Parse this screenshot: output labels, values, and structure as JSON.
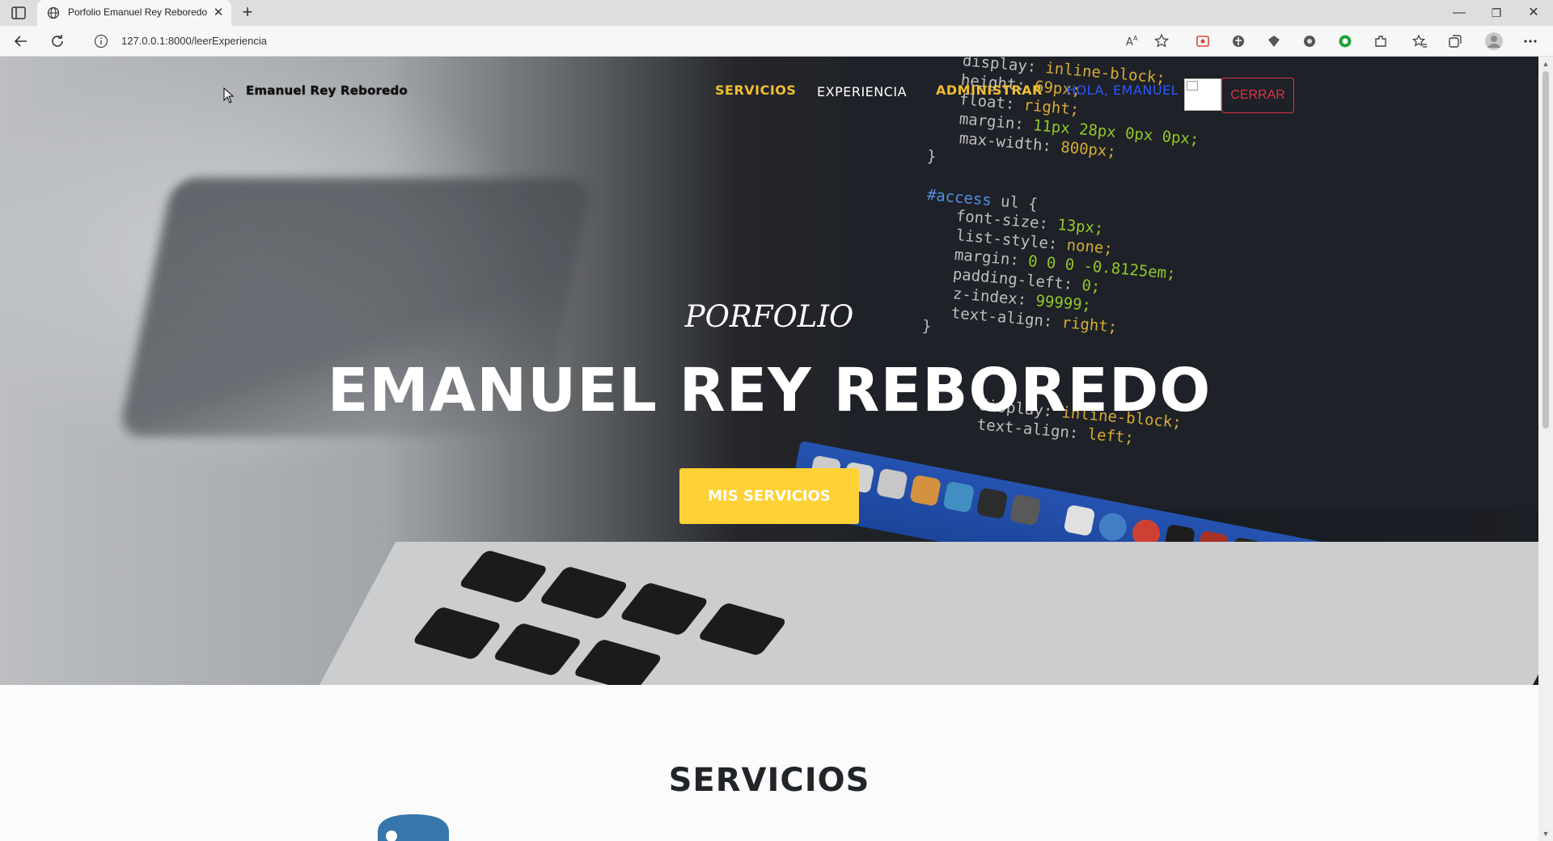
{
  "browser": {
    "tab_title": "Porfolio Emanuel Rey Reboredo",
    "tab_close": "✕",
    "new_tab": "+",
    "url": "127.0.0.1:8000/leerExperiencia",
    "window_controls": {
      "minimize": "—",
      "restore": "❐",
      "close": "✕"
    },
    "toolbar_icons": [
      "read-aloud-icon",
      "favorite-add-icon",
      "extension-pdf-icon",
      "extension-icon",
      "extension-icon",
      "extension-icon",
      "extension-green-icon",
      "extensions-puzzle-icon",
      "favorites-icon",
      "collections-icon",
      "profile-icon",
      "more-icon"
    ]
  },
  "site": {
    "brand": "Emanuel Rey Reboredo",
    "menu": {
      "servicios": "SERVICIOS",
      "experiencia": "EXPERIENCIA",
      "administrar": "ADMINISTRAR",
      "greeting": "HOLA, EMANUEL",
      "logout": "CERRAR"
    },
    "hero": {
      "subtitle": "PORFOLIO",
      "title": "EMANUEL REY REBOREDO",
      "cta": "MIS SERVICIOS"
    },
    "section_title": "SERVICIOS",
    "colors": {
      "accent": "#fed136",
      "nav_accent": "#f1bd32",
      "greeting": "#2b59ff",
      "logout": "#dc3545"
    }
  }
}
